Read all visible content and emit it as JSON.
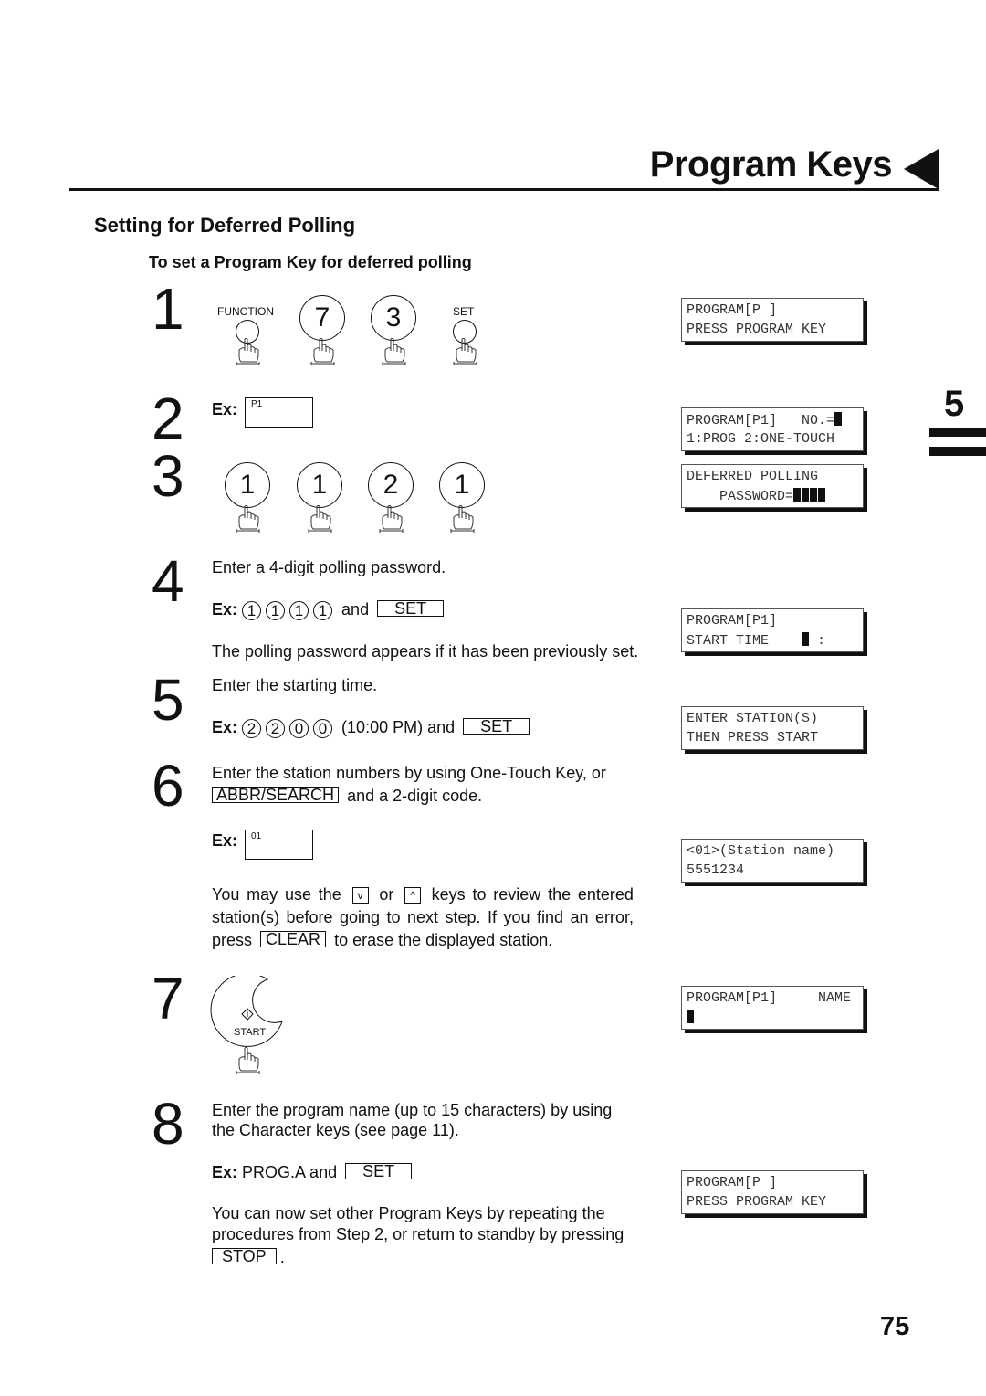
{
  "header": {
    "title": "Program Keys",
    "section_tab": "5",
    "page_number": "75"
  },
  "section_title": "Setting for Deferred Polling",
  "subtitle": "To set a Program Key for deferred polling",
  "steps": {
    "s1": {
      "num": "1",
      "function_label": "FUNCTION",
      "key7": "7",
      "key3": "3",
      "set_label": "SET"
    },
    "s2": {
      "num": "2",
      "ex": "Ex:",
      "ex_value": "P1"
    },
    "s3": {
      "num": "3",
      "keys": [
        "1",
        "1",
        "2",
        "1"
      ]
    },
    "s4": {
      "num": "4",
      "text": "Enter a 4-digit polling password.",
      "ex": "Ex:",
      "digits": [
        "1",
        "1",
        "1",
        "1"
      ],
      "and": "and",
      "set": "SET",
      "note": "The polling password appears if it has been previously set."
    },
    "s5": {
      "num": "5",
      "text": "Enter the starting time.",
      "ex": "Ex:",
      "digits": [
        "2",
        "2",
        "0",
        "0"
      ],
      "time": "(10:00 PM) and",
      "set": "SET"
    },
    "s6": {
      "num": "6",
      "line1": "Enter the station numbers by using One-Touch Key, or",
      "abbr": "ABBR/SEARCH",
      "line2_rest": "and a 2-digit code.",
      "ex": "Ex:",
      "ex_value": "01",
      "p1": "You may use the",
      "down": "v",
      "or": "or",
      "up": "^",
      "p2": "keys to review the entered station(s) before going to next step. If you find an error, press",
      "clear": "CLEAR",
      "p3": "to erase the displayed station."
    },
    "s7": {
      "num": "7",
      "start_label": "START"
    },
    "s8": {
      "num": "8",
      "line1": "Enter the program name (up to 15 characters) by using",
      "line2": "the Character keys (see page 11).",
      "ex": "Ex:",
      "ex_value": "PROG.A and",
      "set": "SET",
      "p1": "You can now set other Program Keys by repeating the",
      "p2": "procedures from Step 2, or return to standby by pressing",
      "stop": "STOP",
      "p3": "."
    }
  },
  "lcd": [
    {
      "l1": "PROGRAM[P ]",
      "l2": "PRESS PROGRAM KEY"
    },
    {
      "l1": "PROGRAM[P1]   NO.=",
      "l2": "1:PROG 2:ONE-TOUCH"
    },
    {
      "l1": "DEFERRED POLLING",
      "l2": "    PASSWORD="
    },
    {
      "l1": "PROGRAM[P1]",
      "l2": "START TIME    "
    },
    {
      "l1": "ENTER STATION(S)",
      "l2": "THEN PRESS START"
    },
    {
      "l1": "<01>(Station name)",
      "l2": "5551234"
    },
    {
      "l1": "PROGRAM[P1]     NAME",
      "l2": ""
    },
    {
      "l1": "PROGRAM[P ]",
      "l2": "PRESS PROGRAM KEY"
    }
  ],
  "lcd_colon": ":",
  "icons": {
    "finger": "pointing-finger-icon",
    "start": "start-diamond-icon",
    "triangle": "triangle-left-icon"
  }
}
